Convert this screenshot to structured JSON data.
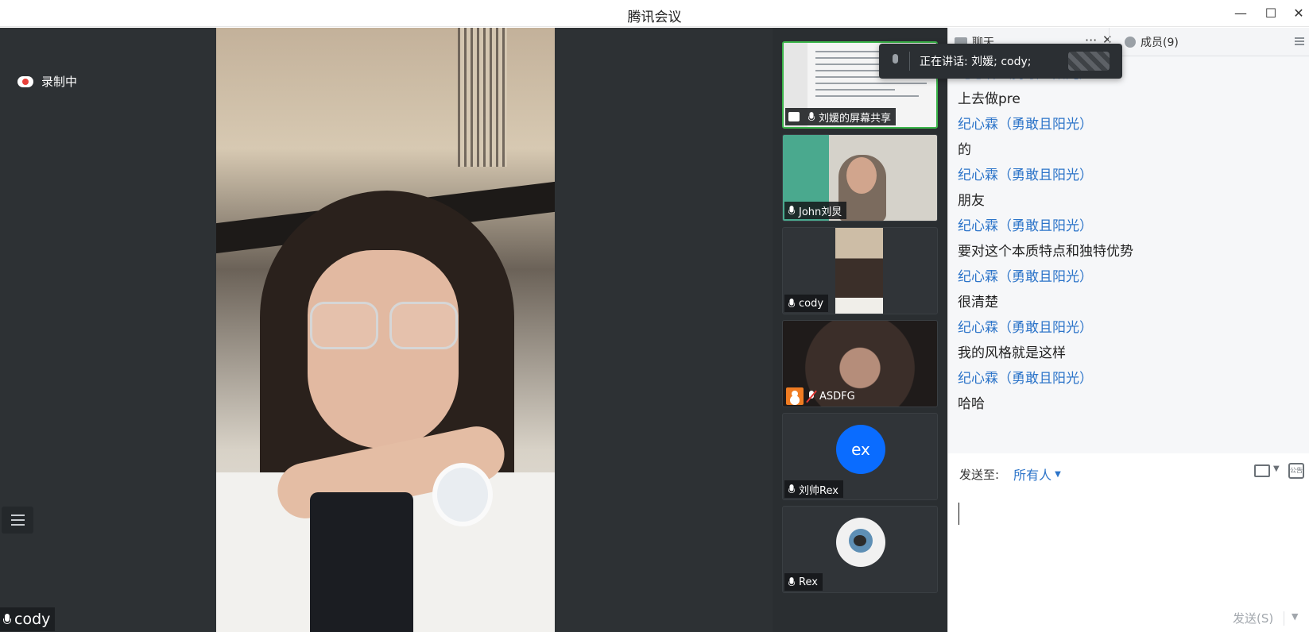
{
  "window": {
    "title": "腾讯会议",
    "minimize": "—",
    "maximize": "☐",
    "close": "✕"
  },
  "stage": {
    "recording_label": "录制中",
    "main_speaker_name": "cody"
  },
  "participants": [
    {
      "name": "刘媛的屏幕共享",
      "kind": "screen-share",
      "mic": "on",
      "active": true
    },
    {
      "name": "John刘炅",
      "kind": "camera",
      "mic": "on"
    },
    {
      "name": "cody",
      "kind": "camera",
      "mic": "on"
    },
    {
      "name": "ASDFG",
      "kind": "camera",
      "mic": "off"
    },
    {
      "name": "刘帅Rex",
      "kind": "avatar",
      "avatar_text": "ex",
      "avatar_color": "#0a6cff",
      "mic": "on"
    },
    {
      "name": "Rex",
      "kind": "avatar",
      "mic": "on"
    }
  ],
  "speaking_toast": {
    "text": "正在讲话: 刘媛; cody;"
  },
  "chat": {
    "tabs": {
      "chat_label": "聊天",
      "more": "···",
      "close": "✕",
      "members_label": "成员(9)"
    },
    "messages": [
      {
        "type": "sender",
        "text": "纪心霖（勇敢且阳光）"
      },
      {
        "type": "text",
        "text": "上去做pre"
      },
      {
        "type": "sender",
        "text": "纪心霖（勇敢且阳光）"
      },
      {
        "type": "text",
        "text": "的"
      },
      {
        "type": "sender",
        "text": "纪心霖（勇敢且阳光）"
      },
      {
        "type": "text",
        "text": "朋友"
      },
      {
        "type": "sender",
        "text": "纪心霖（勇敢且阳光）"
      },
      {
        "type": "text",
        "text": "要对这个本质特点和独特优势"
      },
      {
        "type": "sender",
        "text": "纪心霖（勇敢且阳光）"
      },
      {
        "type": "text",
        "text": "很清楚"
      },
      {
        "type": "sender",
        "text": "纪心霖（勇敢且阳光）"
      },
      {
        "type": "text",
        "text": "我的风格就是这样"
      },
      {
        "type": "sender",
        "text": "纪心霖（勇敢且阳光）"
      },
      {
        "type": "text",
        "text": "哈哈"
      }
    ],
    "compose": {
      "send_to_label": "发送至:",
      "send_to_target": "所有人",
      "notice_icon_text": "公告",
      "send_button": "发送(S)"
    }
  },
  "colors": {
    "accent": "#2c74c9",
    "active_border": "#3bb54a",
    "stage_bg": "#2d3134"
  }
}
